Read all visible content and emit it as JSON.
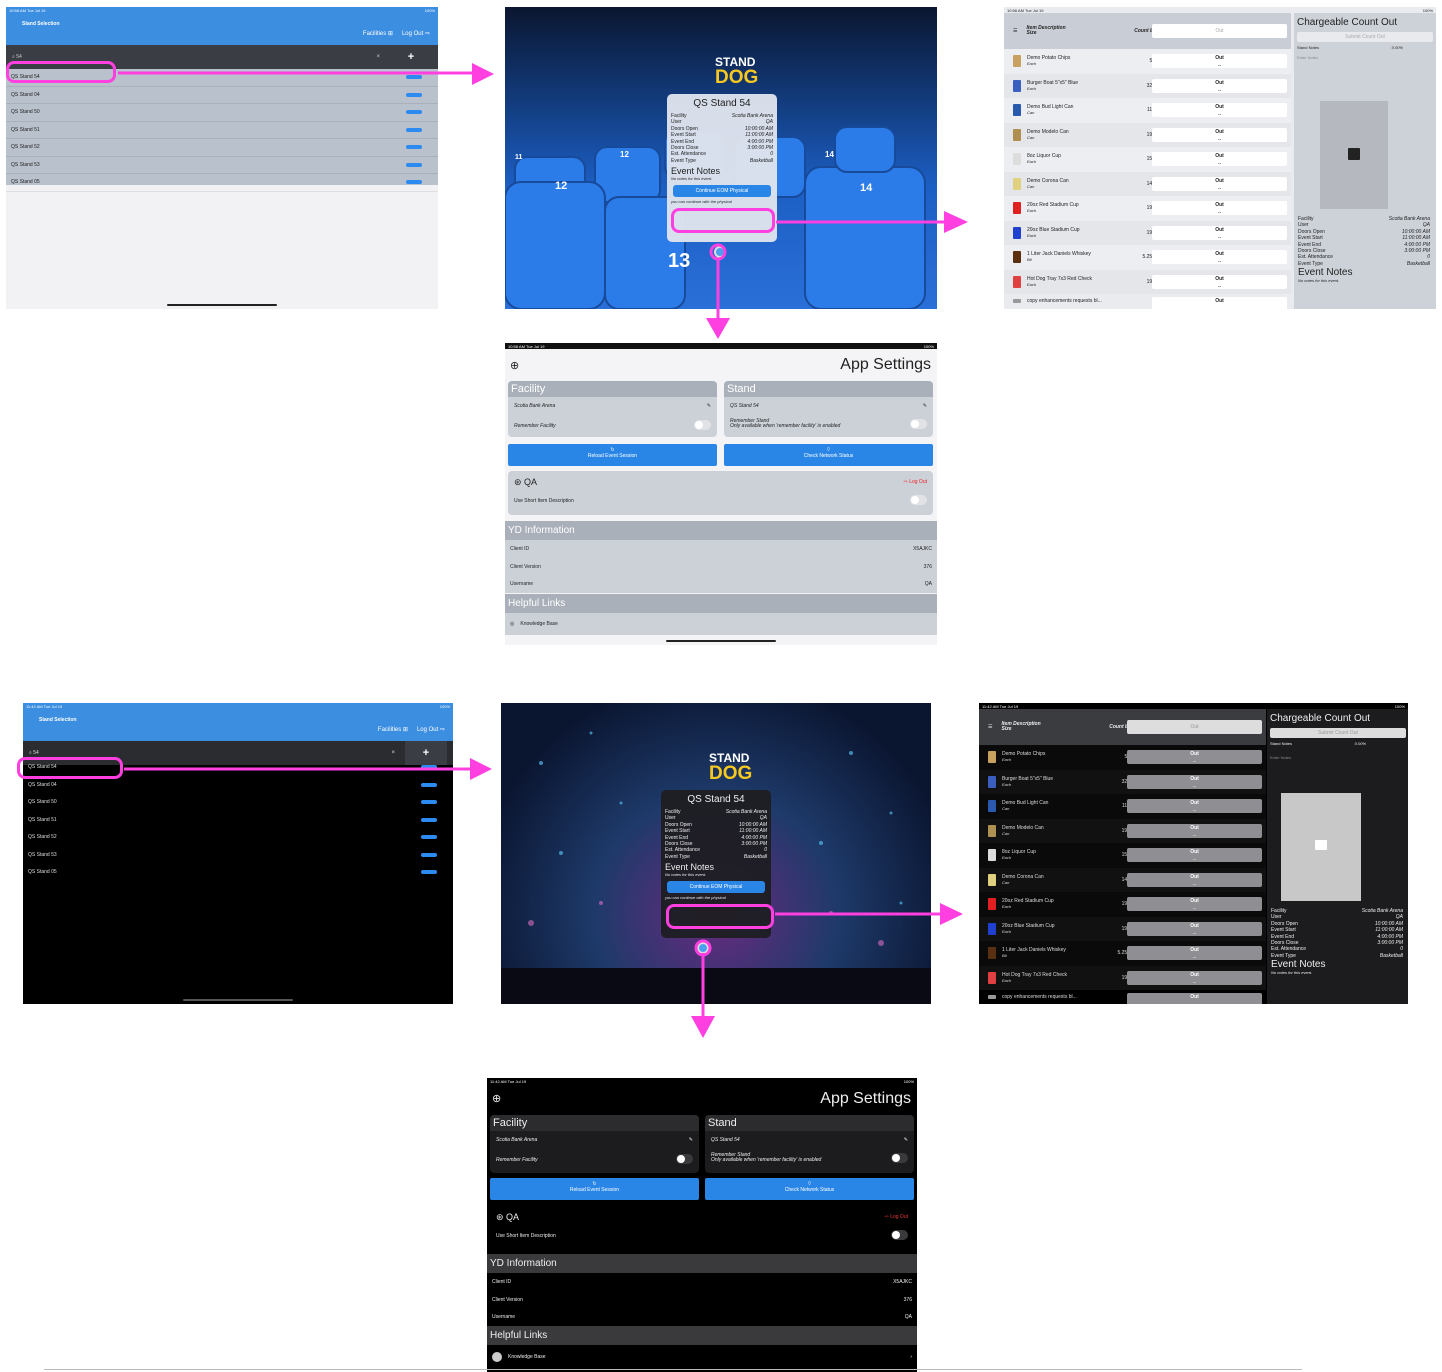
{
  "status": {
    "time_top": "10:58 AM  Tue Jul 19",
    "time_bottom": "11:42 AM  Tue Jul 19",
    "battery": "100%"
  },
  "stand_selection": {
    "title": "Stand Selection",
    "facilities_label": "Facilities ⊞",
    "logout_label": "Log Out ⇨",
    "search_value": "54",
    "clear_icon": "×",
    "add_icon": "+",
    "stands": [
      "QS Stand 54",
      "QS Stand 04",
      "QS Stand 50",
      "QS Stand 51",
      "QS Stand 52",
      "QS Stand 53",
      "QS Stand 05"
    ]
  },
  "event_card": {
    "brand_top": "STAND",
    "brand_bottom": "DOG",
    "stand_name": "QS Stand 54",
    "rows": [
      {
        "k": "Facility",
        "v": "Scotia Bank Arena"
      },
      {
        "k": "User",
        "v": "QA"
      },
      {
        "k": "Doors Open",
        "v": "10:00:00 AM"
      },
      {
        "k": "Event Start",
        "v": "11:00:00 AM"
      },
      {
        "k": "Event End",
        "v": "4:00:00 PM"
      },
      {
        "k": "Doors Close",
        "v": "3:00:00 PM"
      },
      {
        "k": "Est. Attendance",
        "v": "0"
      },
      {
        "k": "Event Type",
        "v": "Basketball"
      }
    ],
    "notes_title": "Event Notes",
    "notes_text": "No notes for this event.",
    "continue_label": "Continue EOM Physical",
    "continue_footer": "you can continue with the physical"
  },
  "count_out": {
    "col_item": "Item Description",
    "col_size": "Size",
    "col_count": "Count In",
    "col_out": "Out",
    "items": [
      {
        "name": "Demo Potato Chips",
        "size": "Each",
        "count": "50",
        "color": "#c8a060"
      },
      {
        "name": "Burger Boat 5\"x5\" Blue",
        "size": "Each",
        "count": "320",
        "color": "#3a5fc0"
      },
      {
        "name": "Demo Bud Light Can",
        "size": "Can",
        "count": "112",
        "color": "#2a5ab0"
      },
      {
        "name": "Demo Modelo Can",
        "size": "Can",
        "count": "192",
        "color": "#b09050"
      },
      {
        "name": "8oz Liquor Cup",
        "size": "Each",
        "count": "150",
        "color": "#dddddd"
      },
      {
        "name": "Demo Corona Can",
        "size": "Can",
        "count": "144",
        "color": "#e0d080"
      },
      {
        "name": "20oz Red Stadium Cup",
        "size": "Each",
        "count": "190",
        "color": "#e02020"
      },
      {
        "name": "20oz Blue Stadium Cup",
        "size": "Each",
        "count": "190",
        "color": "#2040d0"
      },
      {
        "name": "1 Liter Jack Daniels Whiskey",
        "size": "Btl",
        "count": "5.256",
        "color": "#5a3010"
      },
      {
        "name": "Hot Dog Tray 7x3 Red Check",
        "size": "Each",
        "count": "190",
        "color": "#e04040"
      }
    ],
    "last_row": "copy enhancements requests bl...",
    "out_value": "Out",
    "out_sub": "--",
    "side_title": "Chargeable Count Out",
    "submit_label": "Submit Count Out",
    "stand_notes_label": "Stand Notes",
    "stand_notes_pct": "0.00%",
    "notes_placeholder": "Enter Notes",
    "side_rows": [
      {
        "k": "Facility",
        "v": "Scotia Bank Arena"
      },
      {
        "k": "User",
        "v": "QA"
      },
      {
        "k": "Doors Open",
        "v": "10:00:00 AM"
      },
      {
        "k": "Event Start",
        "v": "11:00:00 AM"
      },
      {
        "k": "Event End",
        "v": "4:00:00 PM"
      },
      {
        "k": "Doors Close",
        "v": "3:00:00 PM"
      },
      {
        "k": "Est. Attendance",
        "v": "0"
      },
      {
        "k": "Event Type",
        "v": "Basketball"
      }
    ],
    "side_notes_title": "Event Notes",
    "side_notes_text": "No notes for this event."
  },
  "settings": {
    "title": "App Settings",
    "facility_header": "Facility",
    "facility_value": "Scotia Bank Arena",
    "remember_facility": "Remember Facility",
    "stand_header": "Stand",
    "stand_value": "QS Stand 54",
    "remember_stand": "Remember Stand",
    "remember_stand_note": "Only available when 'remember facility' is enabled",
    "reload_label": "Reload Event Session",
    "network_label": "Check Network Status",
    "user": "QA",
    "logout": "Log Out",
    "short_desc": "Use Short Item Description",
    "yd_header": "YD Information",
    "yd_rows": [
      {
        "k": "Client ID",
        "v": "X5AJKC"
      },
      {
        "k": "Client Version",
        "v": "376"
      },
      {
        "k": "Username",
        "v": "QA"
      }
    ],
    "links_header": "Helpful Links",
    "kb_label": "Knowledge Base"
  },
  "theme": {
    "arrow_color": "#ff3fe0",
    "accent": "#2a86e6"
  }
}
